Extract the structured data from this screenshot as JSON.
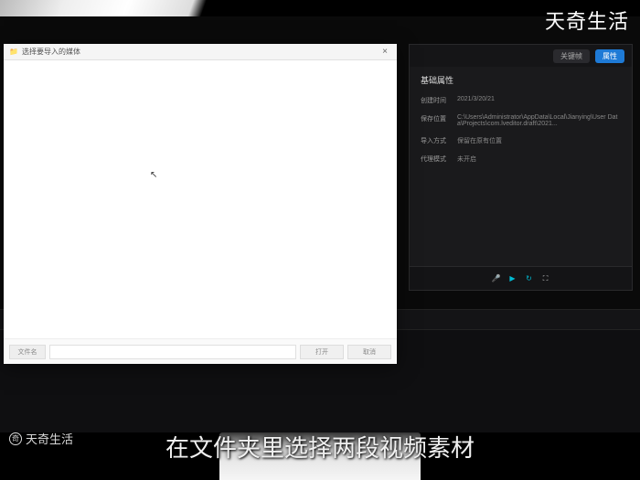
{
  "watermark": {
    "top_right": "天奇生活",
    "bottom_left": "天奇生活",
    "bottom_left_icon": "奇"
  },
  "dialog": {
    "title": "选择要导入的媒体",
    "close_label": "×",
    "filename_label": "文件名",
    "filename_value": "",
    "open_button": "打开",
    "cancel_button": "取消"
  },
  "right_panel": {
    "tabs": [
      {
        "label": "关键帧",
        "active": false
      },
      {
        "label": "属性",
        "active": true
      }
    ],
    "section_title": "基础属性",
    "rows": [
      {
        "label": "创建时间",
        "value": "2021/3/20/21"
      },
      {
        "label": "保存位置",
        "value": "C:\\Users\\Administrator\\AppData\\Local\\Jianying\\User Data\\Projects\\com.lveditor.draft\\2021..."
      },
      {
        "label": "导入方式",
        "value": "保留在原有位置"
      },
      {
        "label": "代理模式",
        "value": "未开启"
      }
    ],
    "controls": {
      "mic_color": "#ccc",
      "play_color": "#00bcd4",
      "loop_color": "#00bcd4",
      "fullscreen_color": "#ccc"
    }
  },
  "subtitle": "在文件夹里选择两段视频素材"
}
